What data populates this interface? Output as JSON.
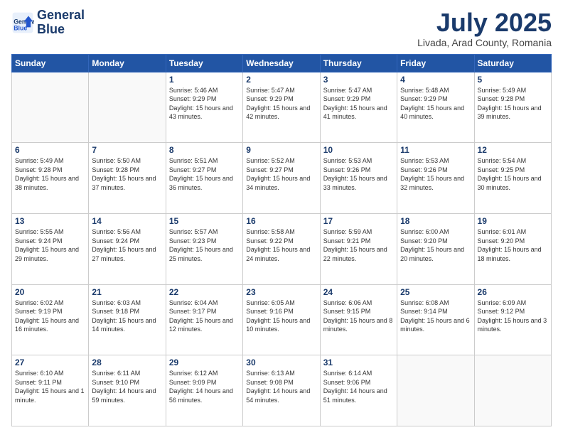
{
  "header": {
    "logo_line1": "General",
    "logo_line2": "Blue",
    "month": "July 2025",
    "location": "Livada, Arad County, Romania"
  },
  "weekdays": [
    "Sunday",
    "Monday",
    "Tuesday",
    "Wednesday",
    "Thursday",
    "Friday",
    "Saturday"
  ],
  "weeks": [
    [
      {
        "day": "",
        "info": ""
      },
      {
        "day": "",
        "info": ""
      },
      {
        "day": "1",
        "info": "Sunrise: 5:46 AM\nSunset: 9:29 PM\nDaylight: 15 hours and 43 minutes."
      },
      {
        "day": "2",
        "info": "Sunrise: 5:47 AM\nSunset: 9:29 PM\nDaylight: 15 hours and 42 minutes."
      },
      {
        "day": "3",
        "info": "Sunrise: 5:47 AM\nSunset: 9:29 PM\nDaylight: 15 hours and 41 minutes."
      },
      {
        "day": "4",
        "info": "Sunrise: 5:48 AM\nSunset: 9:29 PM\nDaylight: 15 hours and 40 minutes."
      },
      {
        "day": "5",
        "info": "Sunrise: 5:49 AM\nSunset: 9:28 PM\nDaylight: 15 hours and 39 minutes."
      }
    ],
    [
      {
        "day": "6",
        "info": "Sunrise: 5:49 AM\nSunset: 9:28 PM\nDaylight: 15 hours and 38 minutes."
      },
      {
        "day": "7",
        "info": "Sunrise: 5:50 AM\nSunset: 9:28 PM\nDaylight: 15 hours and 37 minutes."
      },
      {
        "day": "8",
        "info": "Sunrise: 5:51 AM\nSunset: 9:27 PM\nDaylight: 15 hours and 36 minutes."
      },
      {
        "day": "9",
        "info": "Sunrise: 5:52 AM\nSunset: 9:27 PM\nDaylight: 15 hours and 34 minutes."
      },
      {
        "day": "10",
        "info": "Sunrise: 5:53 AM\nSunset: 9:26 PM\nDaylight: 15 hours and 33 minutes."
      },
      {
        "day": "11",
        "info": "Sunrise: 5:53 AM\nSunset: 9:26 PM\nDaylight: 15 hours and 32 minutes."
      },
      {
        "day": "12",
        "info": "Sunrise: 5:54 AM\nSunset: 9:25 PM\nDaylight: 15 hours and 30 minutes."
      }
    ],
    [
      {
        "day": "13",
        "info": "Sunrise: 5:55 AM\nSunset: 9:24 PM\nDaylight: 15 hours and 29 minutes."
      },
      {
        "day": "14",
        "info": "Sunrise: 5:56 AM\nSunset: 9:24 PM\nDaylight: 15 hours and 27 minutes."
      },
      {
        "day": "15",
        "info": "Sunrise: 5:57 AM\nSunset: 9:23 PM\nDaylight: 15 hours and 25 minutes."
      },
      {
        "day": "16",
        "info": "Sunrise: 5:58 AM\nSunset: 9:22 PM\nDaylight: 15 hours and 24 minutes."
      },
      {
        "day": "17",
        "info": "Sunrise: 5:59 AM\nSunset: 9:21 PM\nDaylight: 15 hours and 22 minutes."
      },
      {
        "day": "18",
        "info": "Sunrise: 6:00 AM\nSunset: 9:20 PM\nDaylight: 15 hours and 20 minutes."
      },
      {
        "day": "19",
        "info": "Sunrise: 6:01 AM\nSunset: 9:20 PM\nDaylight: 15 hours and 18 minutes."
      }
    ],
    [
      {
        "day": "20",
        "info": "Sunrise: 6:02 AM\nSunset: 9:19 PM\nDaylight: 15 hours and 16 minutes."
      },
      {
        "day": "21",
        "info": "Sunrise: 6:03 AM\nSunset: 9:18 PM\nDaylight: 15 hours and 14 minutes."
      },
      {
        "day": "22",
        "info": "Sunrise: 6:04 AM\nSunset: 9:17 PM\nDaylight: 15 hours and 12 minutes."
      },
      {
        "day": "23",
        "info": "Sunrise: 6:05 AM\nSunset: 9:16 PM\nDaylight: 15 hours and 10 minutes."
      },
      {
        "day": "24",
        "info": "Sunrise: 6:06 AM\nSunset: 9:15 PM\nDaylight: 15 hours and 8 minutes."
      },
      {
        "day": "25",
        "info": "Sunrise: 6:08 AM\nSunset: 9:14 PM\nDaylight: 15 hours and 6 minutes."
      },
      {
        "day": "26",
        "info": "Sunrise: 6:09 AM\nSunset: 9:12 PM\nDaylight: 15 hours and 3 minutes."
      }
    ],
    [
      {
        "day": "27",
        "info": "Sunrise: 6:10 AM\nSunset: 9:11 PM\nDaylight: 15 hours and 1 minute."
      },
      {
        "day": "28",
        "info": "Sunrise: 6:11 AM\nSunset: 9:10 PM\nDaylight: 14 hours and 59 minutes."
      },
      {
        "day": "29",
        "info": "Sunrise: 6:12 AM\nSunset: 9:09 PM\nDaylight: 14 hours and 56 minutes."
      },
      {
        "day": "30",
        "info": "Sunrise: 6:13 AM\nSunset: 9:08 PM\nDaylight: 14 hours and 54 minutes."
      },
      {
        "day": "31",
        "info": "Sunrise: 6:14 AM\nSunset: 9:06 PM\nDaylight: 14 hours and 51 minutes."
      },
      {
        "day": "",
        "info": ""
      },
      {
        "day": "",
        "info": ""
      }
    ]
  ]
}
